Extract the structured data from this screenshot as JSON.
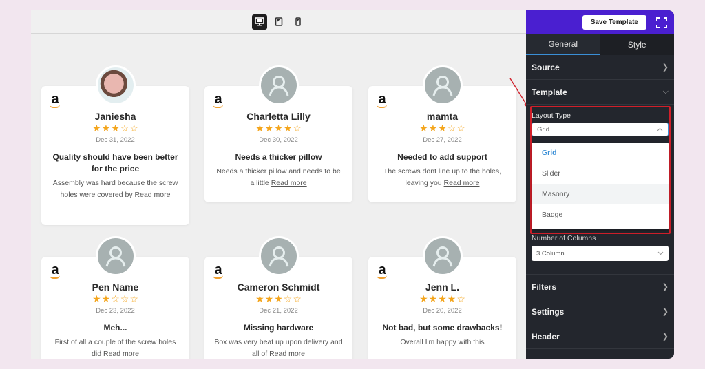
{
  "preview": {
    "device_modes": [
      {
        "name": "desktop",
        "icon": "desktop-icon",
        "active": true
      },
      {
        "name": "tablet",
        "icon": "tablet-icon",
        "active": false
      },
      {
        "name": "mobile",
        "icon": "mobile-icon",
        "active": false
      }
    ],
    "read_more_label": "Read more",
    "reviews": [
      {
        "name": "Janiesha",
        "rating": 3,
        "max_rating": 5,
        "date": "Dec 31, 2022",
        "title": "Quality should have been better for the price",
        "body": "Assembly was hard because the screw holes were covered by",
        "has_photo": true,
        "source_icon": "amazon-logo-icon"
      },
      {
        "name": "Charletta Lilly",
        "rating": 4,
        "max_rating": 5,
        "date": "Dec 30, 2022",
        "title": "Needs a thicker pillow",
        "body": "Needs a thicker pillow and needs to be a little",
        "has_photo": false,
        "source_icon": "amazon-logo-icon"
      },
      {
        "name": "mamta",
        "rating": 3,
        "max_rating": 5,
        "date": "Dec 27, 2022",
        "title": "Needed to add support",
        "body": "The screws dont line up to the holes, leaving you",
        "has_photo": false,
        "source_icon": "amazon-logo-icon"
      },
      {
        "name": "Pen Name",
        "rating": 2,
        "max_rating": 5,
        "date": "Dec 23, 2022",
        "title": "Meh...",
        "body": "First of all a couple of the screw holes did",
        "has_photo": false,
        "source_icon": "amazon-logo-icon"
      },
      {
        "name": "Cameron Schmidt",
        "rating": 3,
        "max_rating": 5,
        "date": "Dec 21, 2022",
        "title": "Missing hardware",
        "body": "Box was very beat up upon delivery and all of",
        "has_photo": false,
        "source_icon": "amazon-logo-icon"
      },
      {
        "name": "Jenn L.",
        "rating": 4,
        "max_rating": 5,
        "date": "Dec 20, 2022",
        "title": "Not bad, but some drawbacks!",
        "body": "Overall I'm happy with this",
        "has_photo": false,
        "source_icon": "amazon-logo-icon"
      }
    ]
  },
  "sidebar": {
    "save_label": "Save Template",
    "tabs": [
      {
        "label": "General",
        "active": true
      },
      {
        "label": "Style",
        "active": false
      }
    ],
    "sections_top": [
      {
        "label": "Source",
        "state": "collapsed"
      },
      {
        "label": "Template",
        "state": "expanded"
      }
    ],
    "layout_type": {
      "label": "Layout Type",
      "value": "Grid",
      "options": [
        {
          "label": "Grid",
          "selected": true,
          "hover": false
        },
        {
          "label": "Slider",
          "selected": false,
          "hover": false
        },
        {
          "label": "Masonry",
          "selected": false,
          "hover": true
        },
        {
          "label": "Badge",
          "selected": false,
          "hover": false
        }
      ]
    },
    "columns": {
      "label": "Number of Columns",
      "value": "3 Column"
    },
    "sections_bottom": [
      {
        "label": "Filters"
      },
      {
        "label": "Settings"
      },
      {
        "label": "Header"
      }
    ]
  },
  "colors": {
    "accent_purple": "#4a1fd0",
    "accent_blue": "#3a8fd6",
    "star": "#f4a51c",
    "highlight_red": "#d11f2a"
  }
}
